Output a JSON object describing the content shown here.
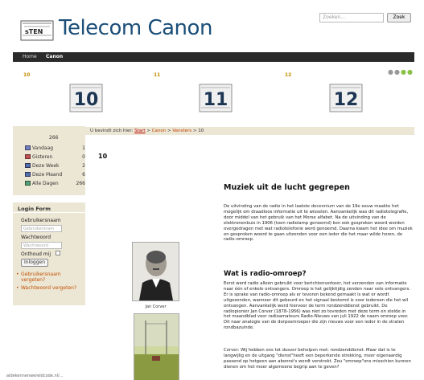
{
  "header": {
    "logo_text": "sTEN",
    "site_title": "Telecom Canon",
    "search_placeholder": "Zoeken...",
    "search_button": "Zoek"
  },
  "nav": {
    "items": [
      {
        "label": "Home"
      },
      {
        "label": "Canon"
      }
    ]
  },
  "slider": {
    "labels": [
      "10",
      "11",
      "12"
    ],
    "thumbs": [
      "10",
      "11",
      "12"
    ]
  },
  "breadcrumb": {
    "prefix": "U bevindt zich hier:",
    "start": "Start",
    "sep": ">",
    "canon": "Canon",
    "vensters": "Vensters",
    "current": "10"
  },
  "stats": {
    "total": "266",
    "rows": [
      {
        "label": "Vandaag",
        "value": "1"
      },
      {
        "label": "Gisteren",
        "value": "0"
      },
      {
        "label": "Deze Week",
        "value": "2"
      },
      {
        "label": "Deze Maand",
        "value": "6"
      },
      {
        "label": "Alle Dagen",
        "value": "266"
      }
    ]
  },
  "login": {
    "title": "Login Form",
    "username_label": "Gebruikersnaam",
    "username_placeholder": "Gebruikersnam",
    "password_label": "Wachtwoord",
    "password_placeholder": "Wachtwoord",
    "remember_label": "Onthoud mij",
    "login_button": "Inloggen",
    "forgot_username": "Gebruikersnaam vergeten?",
    "forgot_password": "Wachtwoord vergeten?"
  },
  "footer": {
    "url": "aldekennenwereldcode.nl/..."
  },
  "main": {
    "page_title": "10",
    "photo_caption": "Jan Corver",
    "article_title": "Muziek uit de lucht gegrepen",
    "para1": "De uitvinding van de radio in het laatste decennium van de 19e eeuw maakte het mogelijk om draadloos informatie uit te wisselen. Aanvankelijk was dit radiotelegrafie, door middel van het gebruik van het Morse alfabet. Na de uitvinding van de elektronenbuis in 1906 (toen radiolamp genoemd) kon ook gesproken woord worden overgedragen met wat radiotelefonie werd genoemd. Daarna kwam het idee om muziek en gesproken woord te gaan uitzenden voor een ieder die het maar wilde horen, de radio-omroep.",
    "subtitle": "Wat is radio-omroep?",
    "para2": "Eerst werd radio alleen gebruikt voor berichtenverkeer, het  verzenden van informatie naar één of enkele ontvangers. Omroep is het gelijktijdig zenden naar vele ontvangers. Er is sprake van radio-omroep als er tevoren bekend gemaakt is wat er wordt uitgezonden, wanneer dit gebeurd en het signaal bestemd is voor iedereen die het wil ontvangen. Aanvankelijk werd hiervoor de term rondzenddienst gebruikt. De radiopionier Jan Corver (1878-1956) was niet zo tevreden met deze term en stelde in het maandblad voor radioamateurs Radio-Nieuws van juli 1922  de naam omroep voor. Dit naar analogie van de dorpsomroeper die zijn nieuws voor een ieder in de straten rondbazuinde.",
    "para3": "Corver: Wij hebben ons tot dusver beholpen met: rondzenddienst. Maar dat is te langwijlig en de uitgang \"dienst\"heeft een beperkende strekking, meer eigenaardig passend op hetgeen aan abonné's wordt verstrekt. Zou \"omroep\"ons misschien kunnen dienen om het meer algemeene begrip aan te geven?"
  },
  "colors": {
    "brand_blue": "#1b4e78",
    "sidebar_bg": "#ece6d4",
    "nav_bg": "#2a2a2a",
    "link_orange": "#c05000",
    "slide_label": "#c28a00"
  }
}
